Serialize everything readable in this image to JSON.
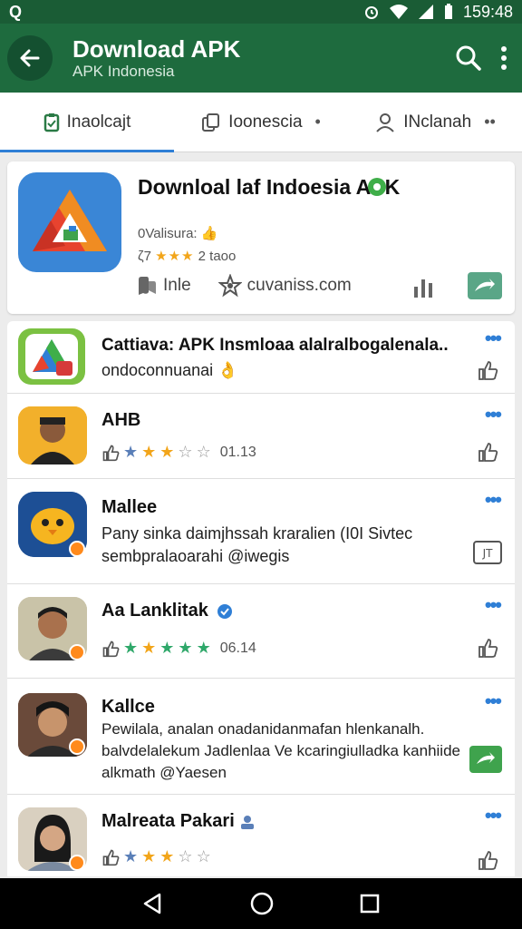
{
  "status_bar": {
    "left_icon": "Q",
    "time": "159:48"
  },
  "app_bar": {
    "title": "Download APK",
    "subtitle": "APK Indonesia"
  },
  "tabs": [
    {
      "label": "Inaolcajt",
      "icon": "clipboard-icon"
    },
    {
      "label": "Ioonescia",
      "icon": "copy-icon"
    },
    {
      "label": "INclanah",
      "icon": "person-icon"
    }
  ],
  "feature": {
    "title": "Downloal laf Indoesia APK",
    "meta1": "0Valisura: 👍",
    "meta2_prefix": "ζ7",
    "meta2_stars": "★★★",
    "meta2_suffix": "2 taoo",
    "action1": "Inle",
    "action2": "cuvaniss.com"
  },
  "items": [
    {
      "name": "Cattiava: APK Insmloaa alalralbogalenala..",
      "desc": "ondoconnuanai 👌"
    },
    {
      "name": "AHB",
      "rating_text": "01.13"
    },
    {
      "name": "Mallee",
      "desc": "Pany sinka daimjhssah kraralien (I0I Sivtec sembpralaoarahi @iwegis"
    },
    {
      "name": "Aa Lanklitak",
      "rating_text": "06.14"
    },
    {
      "name": "Kallce",
      "desc": "Pewilala, analan onadanidanmafan hlenkanalh. balvdelalekum Jadlenlaa Ve kcaringiulladka kanhiide alkmath @Yaesen"
    },
    {
      "name": "Malreata Pakari"
    }
  ],
  "colors": {
    "app_bar": "#1e6b3e",
    "status_bar": "#1a5c35",
    "accent": "#2f7fd6",
    "star": "#f2a51a"
  }
}
